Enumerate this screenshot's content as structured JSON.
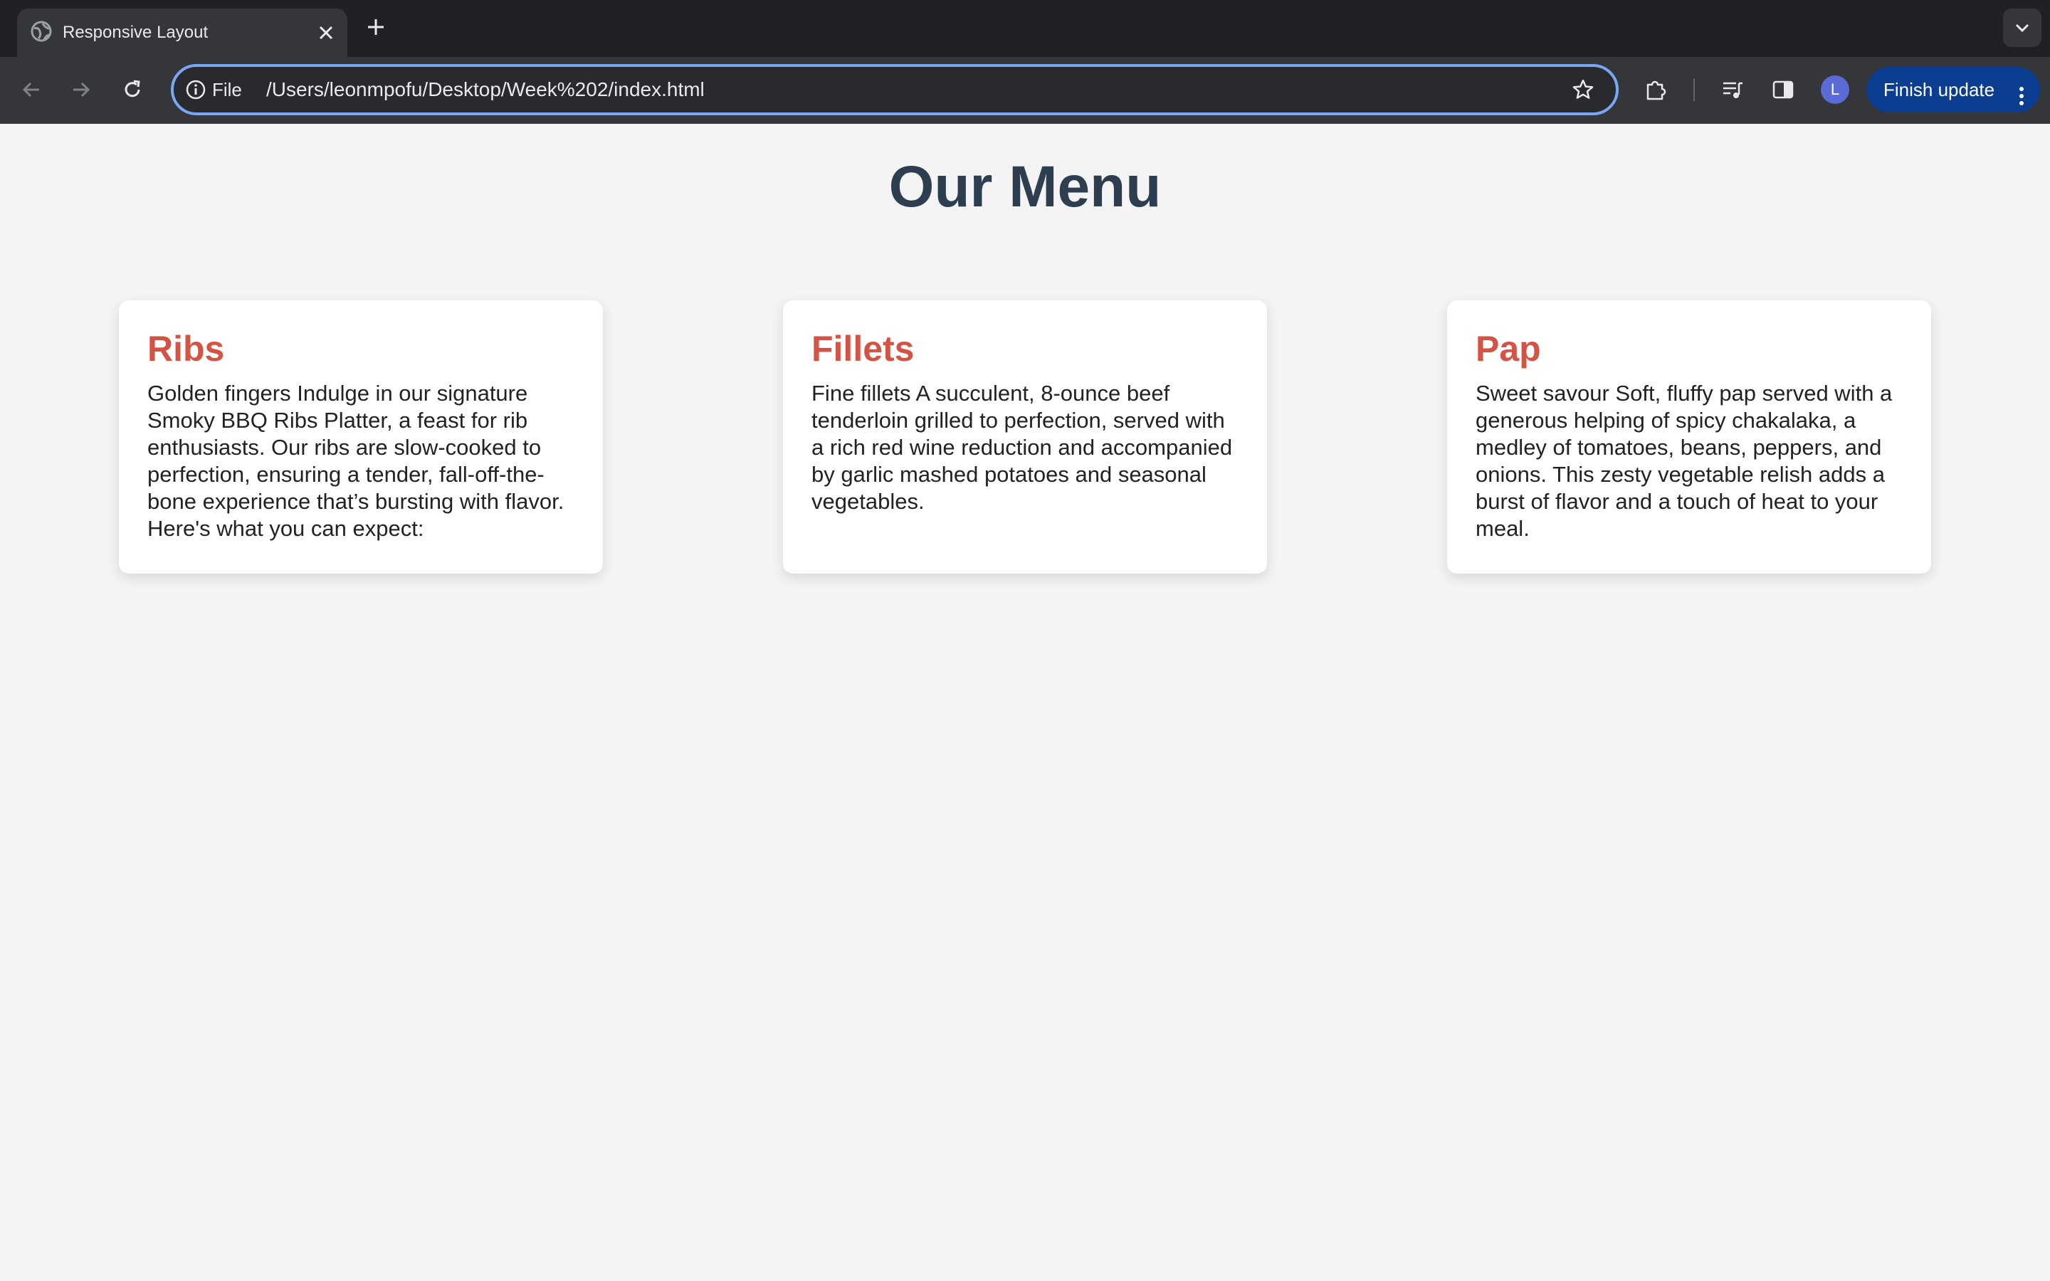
{
  "browser": {
    "tab_title": "Responsive Layout",
    "omnibox": {
      "scheme_label": "File",
      "url": "/Users/leonmpofu/Desktop/Week%202/index.html"
    },
    "profile_initial": "L",
    "update_button_label": "Finish update",
    "icons": [
      "globe-icon",
      "close-icon",
      "plus-icon",
      "chevron-down-icon",
      "back-icon",
      "forward-icon",
      "reload-icon",
      "info-icon",
      "star-icon",
      "extensions-icon",
      "media-controls-icon",
      "side-panel-icon",
      "more-vert-icon"
    ]
  },
  "page": {
    "title": "Our Menu",
    "cards": [
      {
        "heading": "Ribs",
        "text": "Golden fingers Indulge in our signature Smoky BBQ Ribs Platter, a feast for rib enthusiasts. Our ribs are slow-cooked to perfection, ensuring a tender, fall-off-the-bone experience that’s bursting with flavor. Here's what you can expect:"
      },
      {
        "heading": "Fillets",
        "text": "Fine fillets A succulent, 8-ounce beef tenderloin grilled to perfection, served with a rich red wine reduction and accompanied by garlic mashed potatoes and seasonal vegetables."
      },
      {
        "heading": "Pap",
        "text": "Sweet savour Soft, fluffy pap served with a generous helping of spicy chakalaka, a medley of tomatoes, beans, peppers, and onions. This zesty vegetable relish adds a burst of flavor and a touch of heat to your meal."
      }
    ]
  },
  "colors": {
    "page_background": "#f4f4f4",
    "title": "#2c3e50",
    "card_heading": "#d35445",
    "omnibox_focus": "#7aa7f5",
    "update_button": "#0b3d91"
  }
}
